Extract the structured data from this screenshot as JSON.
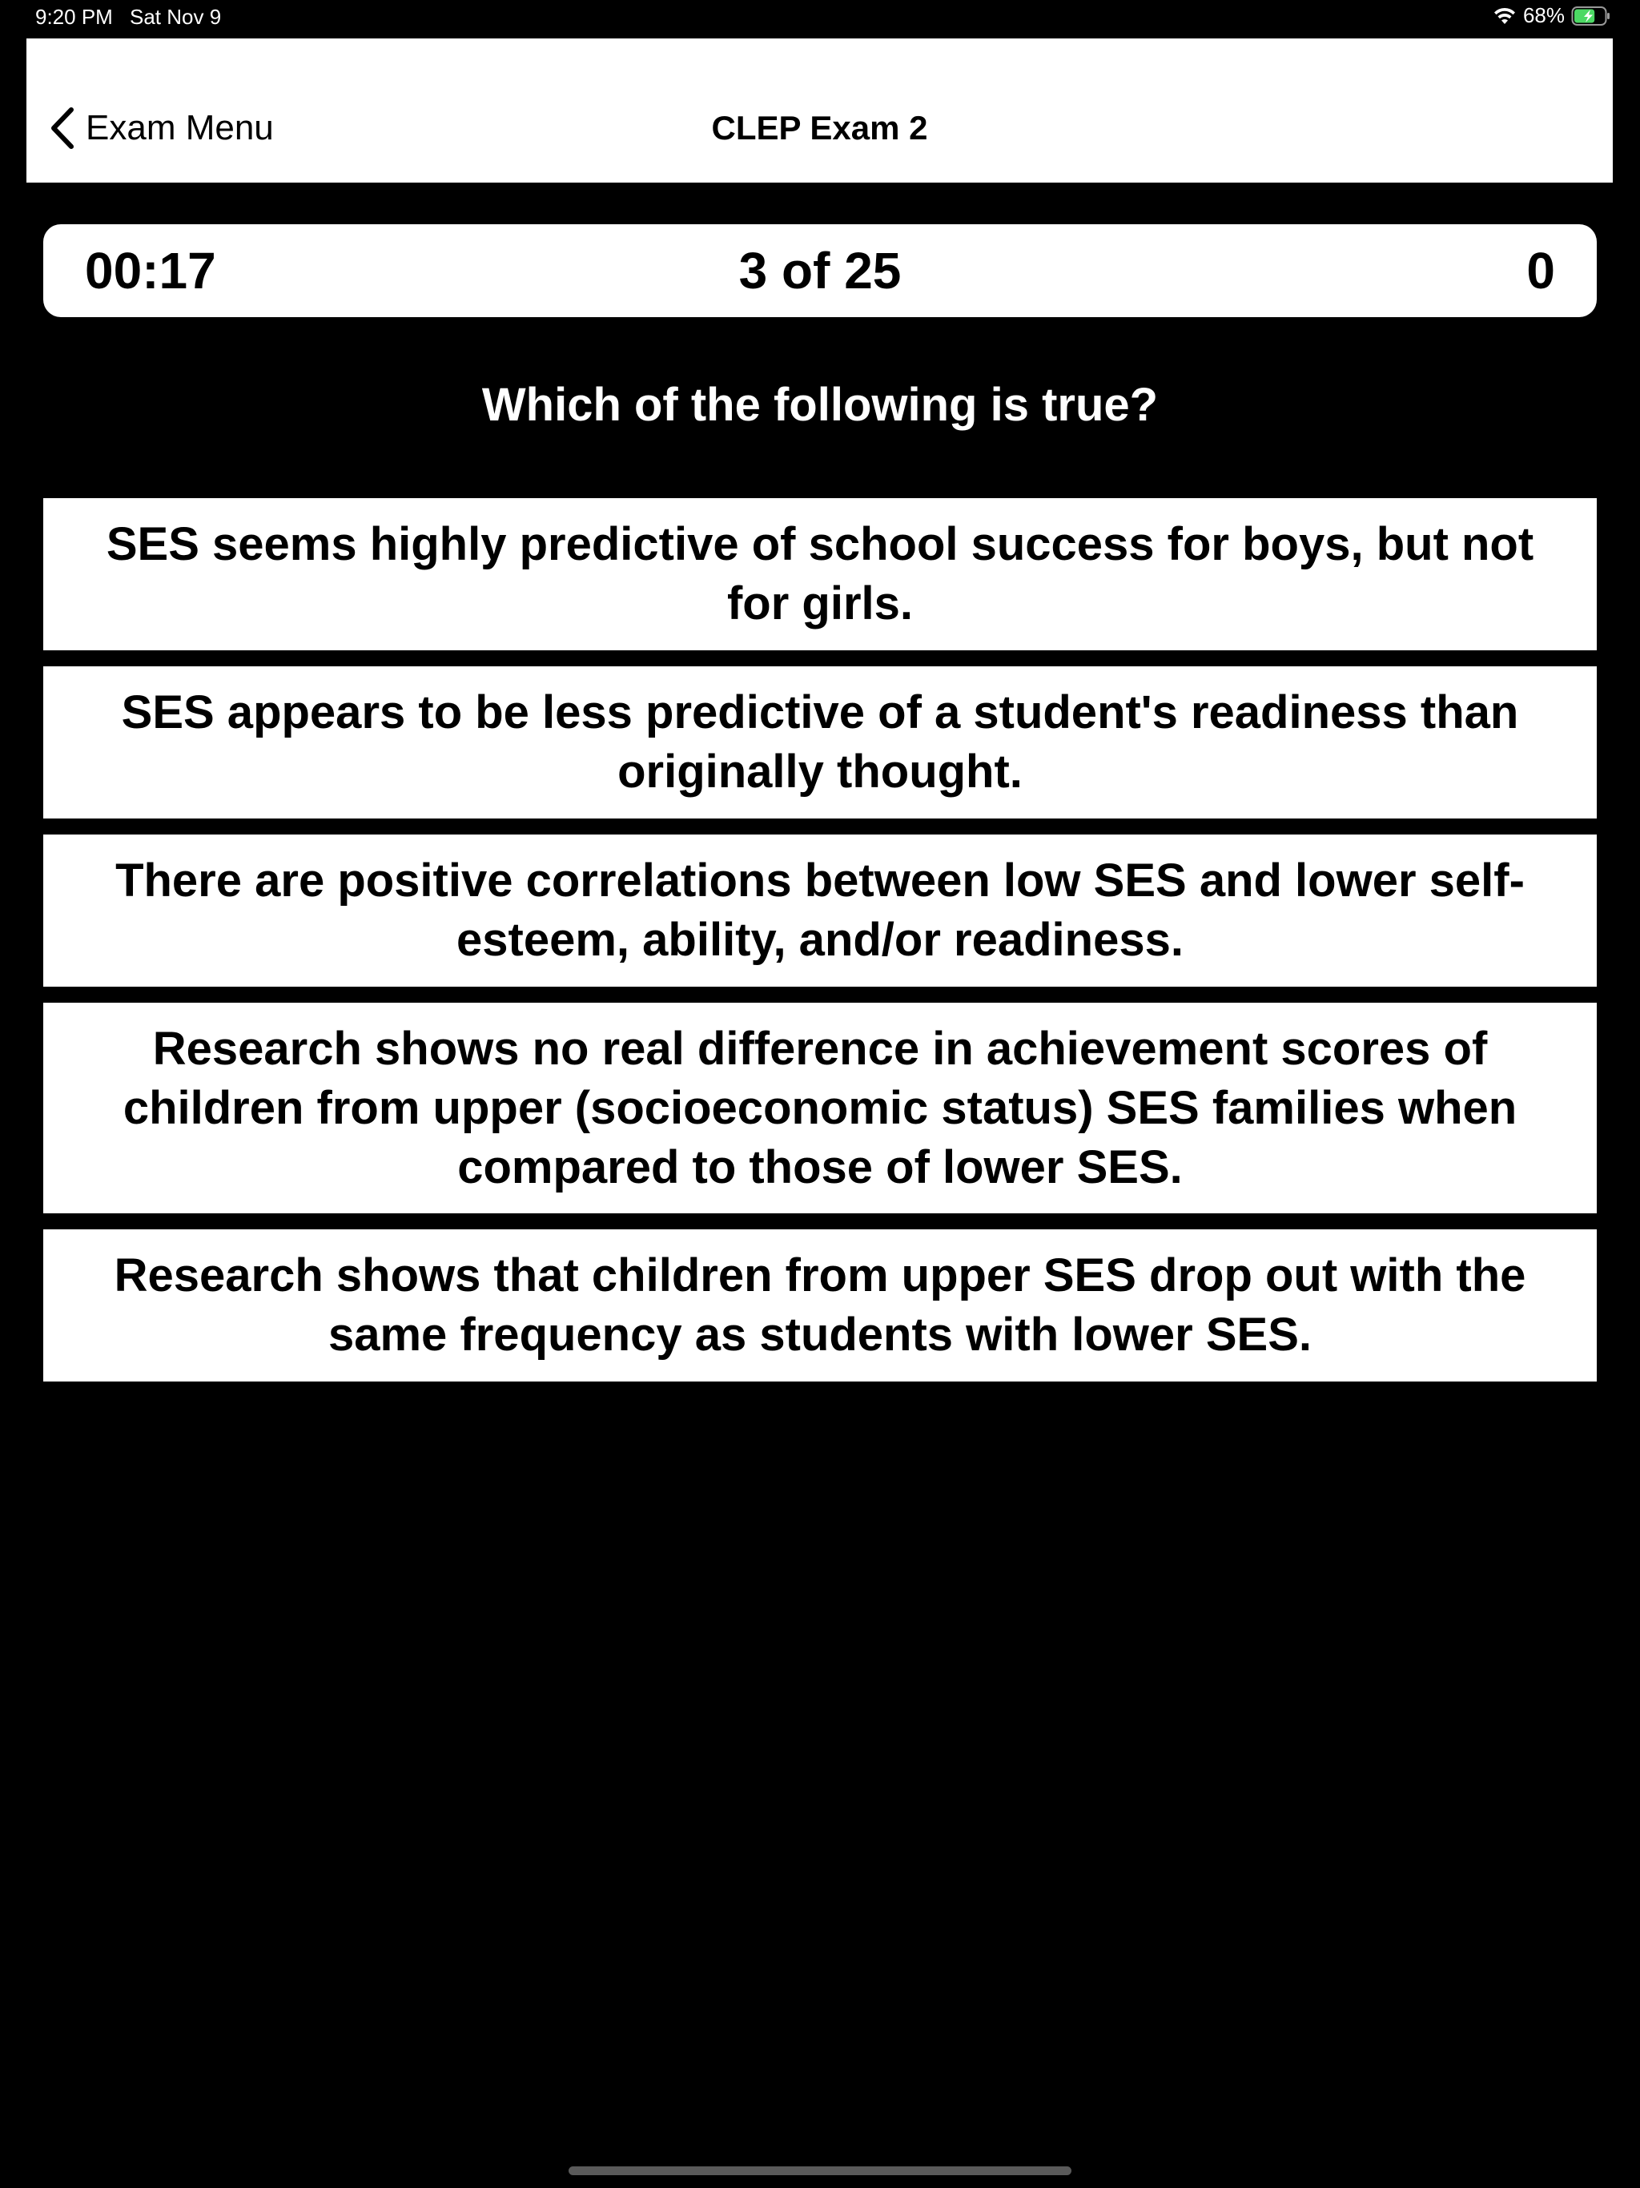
{
  "status_bar": {
    "time": "9:20 PM",
    "date": "Sat Nov 9",
    "battery_percent": "68%",
    "battery_level": 0.68,
    "wifi_icon": "wifi-icon",
    "battery_icon": "battery-charging-icon"
  },
  "nav": {
    "back_label": "Exam Menu",
    "back_icon": "chevron-left-icon",
    "title": "CLEP Exam 2"
  },
  "progress": {
    "timer": "00:17",
    "counter": "3 of 25",
    "score": "0"
  },
  "question": {
    "text": "Which of the following is true?"
  },
  "answers": [
    {
      "text": "SES seems highly predictive of school success for boys, but not for girls."
    },
    {
      "text": "SES appears to be less predictive of a student's readiness than originally thought."
    },
    {
      "text": "There are positive correlations between low SES and lower self-esteem, ability, and/or readiness."
    },
    {
      "text": "Research shows no real difference in achievement scores of children from upper (socioeconomic status) SES families when compared to those of lower SES."
    },
    {
      "text": "Research shows that children from upper SES drop out with the same frequency as students with lower SES."
    }
  ],
  "colors": {
    "background": "#000000",
    "surface": "#ffffff",
    "battery_fill": "#4cd964"
  }
}
